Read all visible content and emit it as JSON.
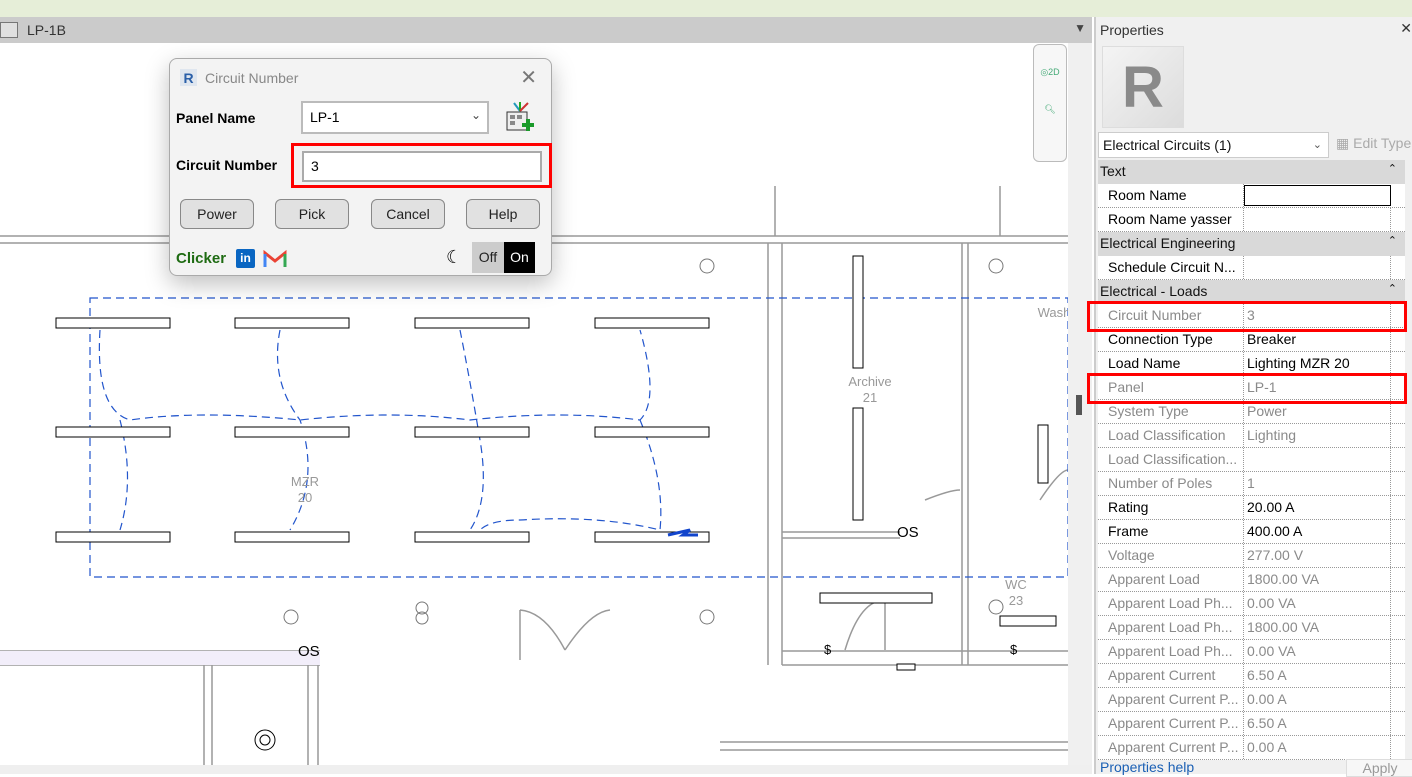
{
  "view_tab": {
    "title": "LP-1B",
    "menu_icon": "triangle-down"
  },
  "floor_plan": {
    "rooms": [
      {
        "name": "MZR",
        "number": "20"
      },
      {
        "name": "Archive",
        "number": "21"
      },
      {
        "name": "WC",
        "number": "23"
      },
      {
        "name": "Wash"
      }
    ],
    "sensor_label": "OS",
    "switch_symbol": "$"
  },
  "dialog": {
    "title": "Circuit Number",
    "panel_name_label": "Panel Name",
    "panel_name_value": "LP-1",
    "circuit_number_label": "Circuit Number",
    "circuit_number_value": "3",
    "buttons": {
      "power": "Power",
      "pick": "Pick",
      "cancel": "Cancel",
      "help": "Help"
    },
    "brand": "Clicker",
    "linkedin": "in",
    "toggle_off": "Off",
    "toggle_on": "On",
    "highlight_color": "#ff0000"
  },
  "properties": {
    "title": "Properties",
    "type_selector": "Electrical Circuits (1)",
    "edit_type": "Edit Type",
    "groups": [
      {
        "name": "Text",
        "rows": [
          {
            "k": "Room Name",
            "v": "",
            "ro": false
          },
          {
            "k": "Room Name yasser",
            "v": "",
            "ro": false
          }
        ]
      },
      {
        "name": "Electrical Engineering",
        "rows": [
          {
            "k": "Schedule Circuit N...",
            "v": "",
            "ro": false
          }
        ]
      },
      {
        "name": "Electrical - Loads",
        "rows": [
          {
            "k": "Circuit Number",
            "v": "3",
            "ro": true
          },
          {
            "k": "Connection Type",
            "v": "Breaker",
            "ro": false
          },
          {
            "k": "Load Name",
            "v": "Lighting MZR 20",
            "ro": false
          },
          {
            "k": "Panel",
            "v": "LP-1",
            "ro": true
          },
          {
            "k": "System Type",
            "v": "Power",
            "ro": true
          },
          {
            "k": "Load Classification",
            "v": "Lighting",
            "ro": true
          },
          {
            "k": "Load Classification...",
            "v": "",
            "ro": true
          },
          {
            "k": "Number of Poles",
            "v": "1",
            "ro": true
          },
          {
            "k": "Rating",
            "v": "20.00 A",
            "ro": false
          },
          {
            "k": "Frame",
            "v": "400.00 A",
            "ro": false
          },
          {
            "k": "Voltage",
            "v": "277.00 V",
            "ro": true
          },
          {
            "k": "Apparent Load",
            "v": "1800.00 VA",
            "ro": true
          },
          {
            "k": "Apparent Load Ph...",
            "v": "0.00 VA",
            "ro": true
          },
          {
            "k": "Apparent Load Ph...",
            "v": "1800.00 VA",
            "ro": true
          },
          {
            "k": "Apparent Load Ph...",
            "v": "0.00 VA",
            "ro": true
          },
          {
            "k": "Apparent Current",
            "v": "6.50 A",
            "ro": true
          },
          {
            "k": "Apparent Current P...",
            "v": "0.00 A",
            "ro": true
          },
          {
            "k": "Apparent Current P...",
            "v": "6.50 A",
            "ro": true
          },
          {
            "k": "Apparent Current P...",
            "v": "0.00 A",
            "ro": true
          }
        ]
      }
    ],
    "help_link": "Properties help",
    "apply": "Apply"
  }
}
